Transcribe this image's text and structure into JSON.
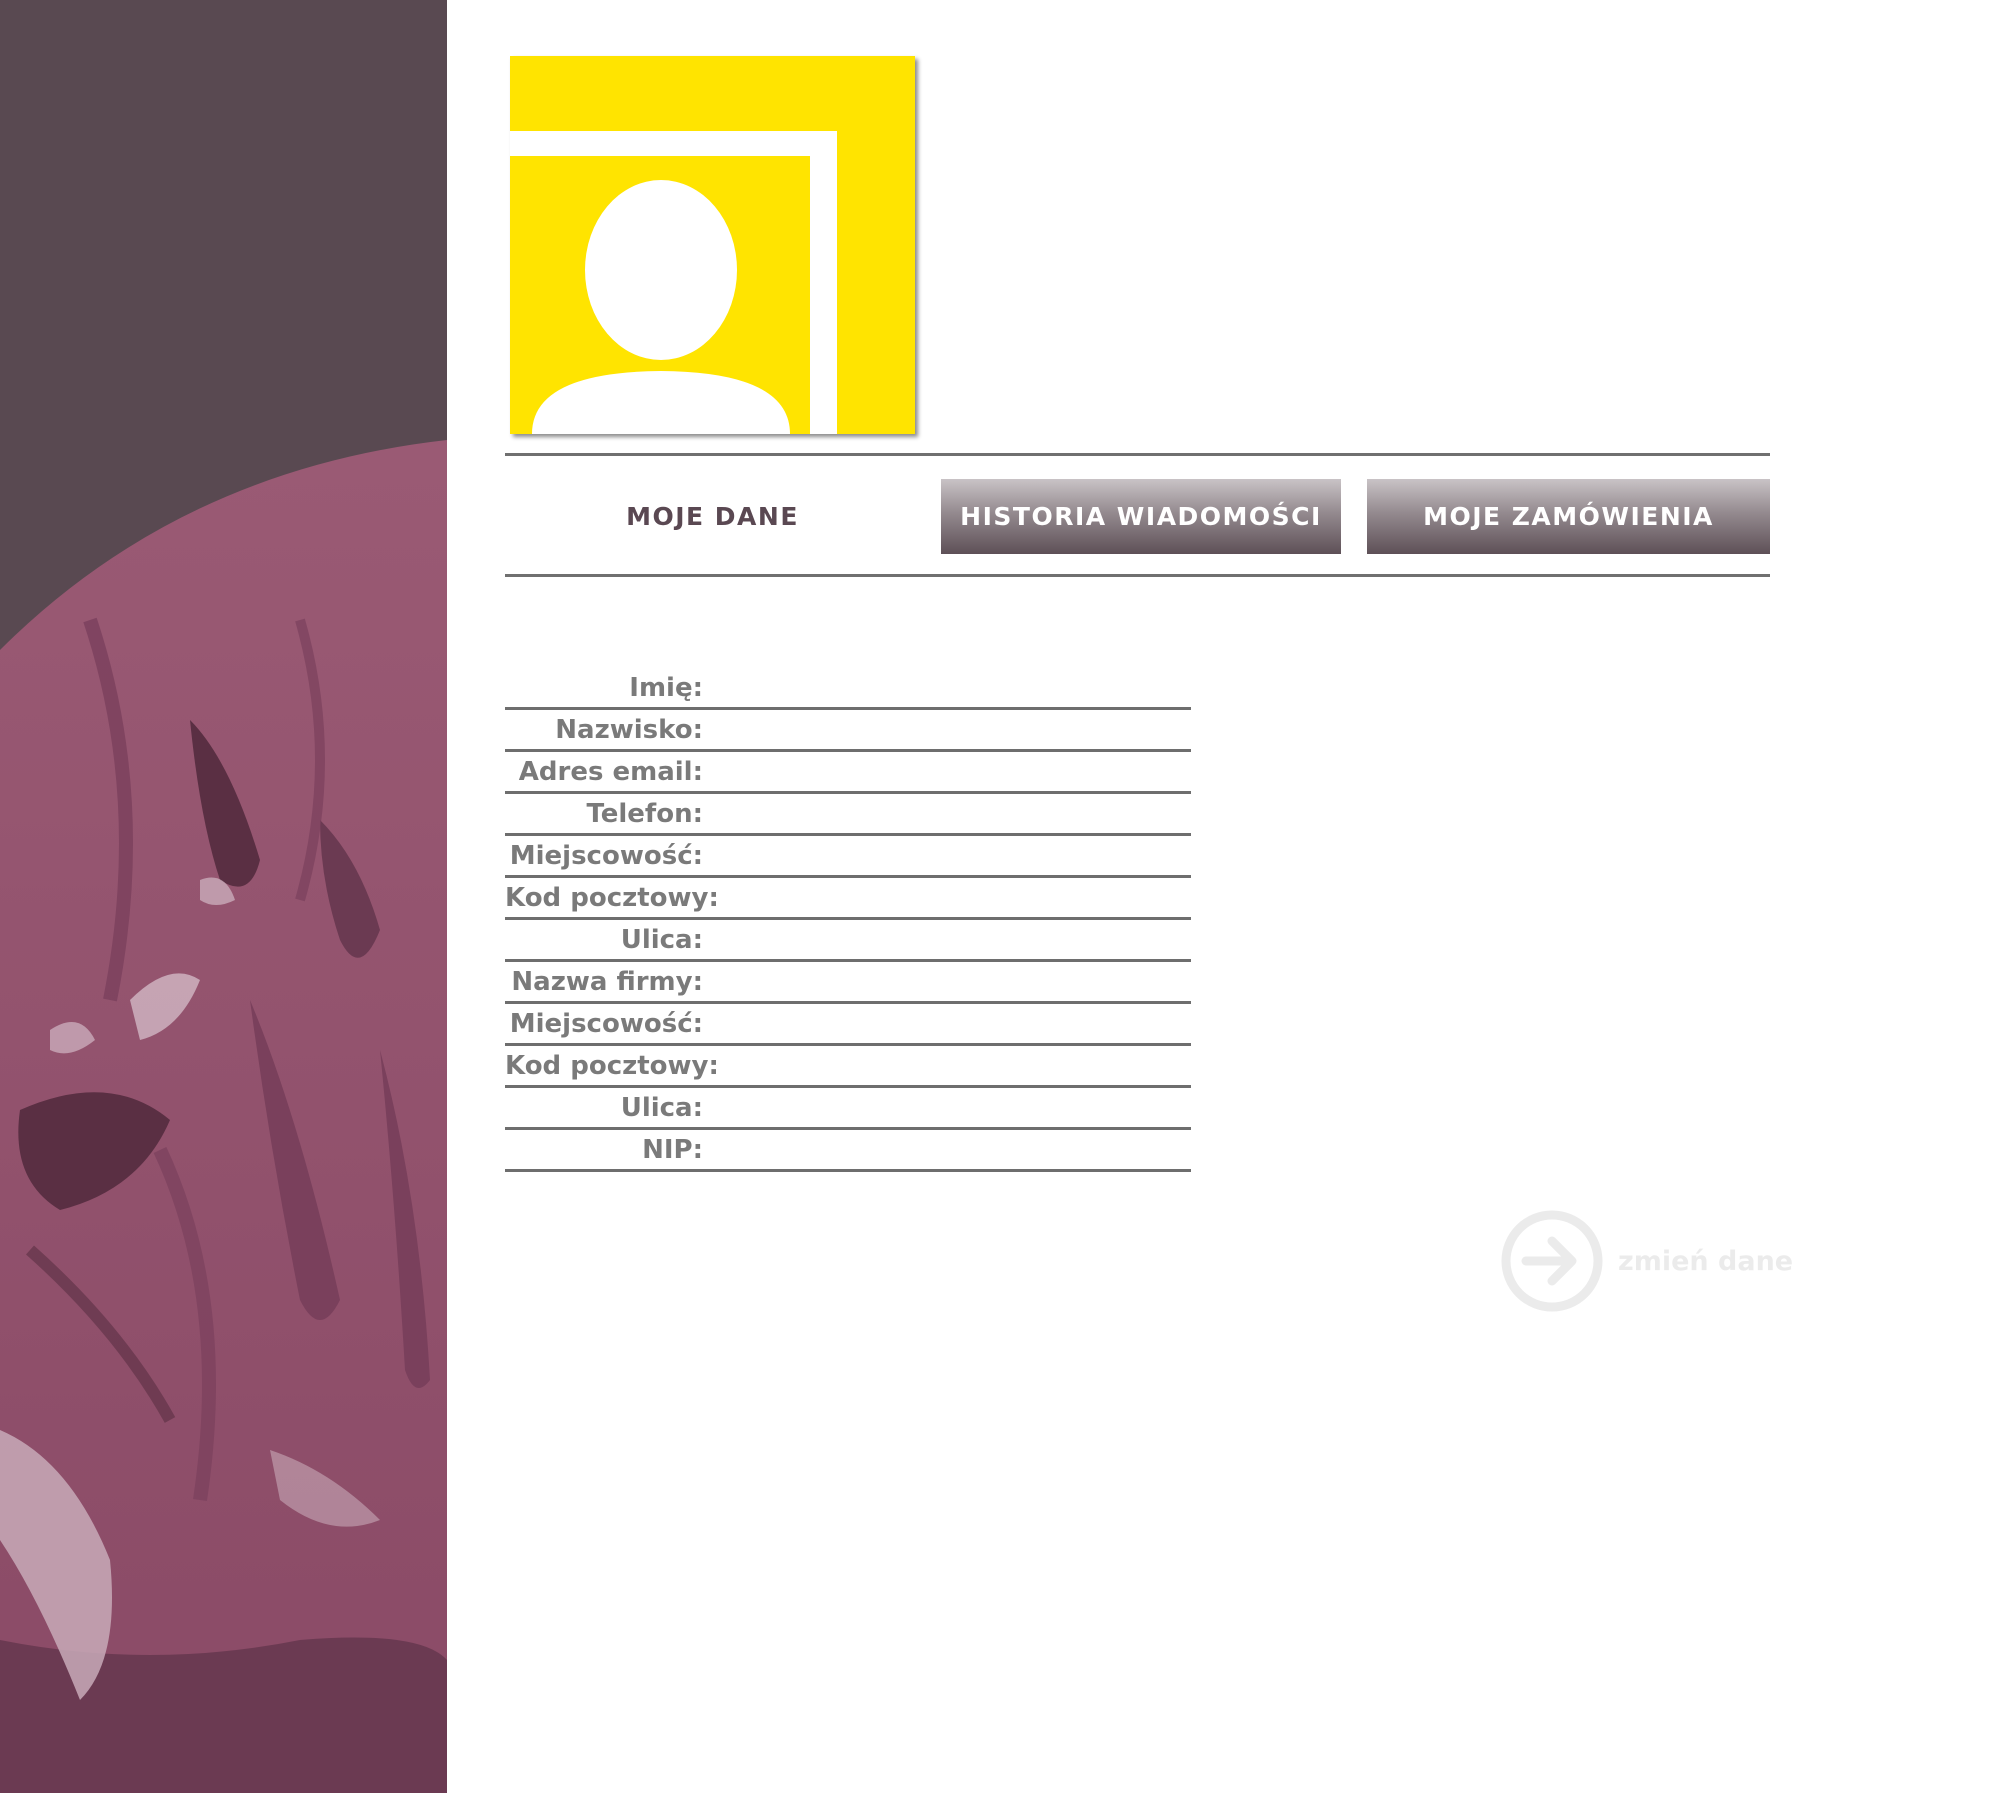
{
  "tabs": [
    {
      "label": "MOJE  DANE",
      "active": true
    },
    {
      "label": "HISTORIA  WIADOMOŚCI",
      "active": false
    },
    {
      "label": "MOJE  ZAMÓWIENIA",
      "active": false
    }
  ],
  "fields": [
    {
      "label": "Imię:",
      "value": ""
    },
    {
      "label": "Nazwisko:",
      "value": ""
    },
    {
      "label": "Adres email:",
      "value": ""
    },
    {
      "label": "Telefon:",
      "value": ""
    },
    {
      "label": "Miejscowość:",
      "value": ""
    },
    {
      "label": "Kod pocztowy:",
      "value": ""
    },
    {
      "label": "Ulica:",
      "value": ""
    },
    {
      "label": "Nazwa firmy:",
      "value": ""
    },
    {
      "label": "Miejscowość:",
      "value": ""
    },
    {
      "label": "Kod pocztowy:",
      "value": ""
    },
    {
      "label": "Ulica:",
      "value": ""
    },
    {
      "label": "NIP:",
      "value": ""
    }
  ],
  "change_link": {
    "label": "zmień dane",
    "icon": "arrow-right-circle-icon"
  },
  "avatar": {
    "icon": "user-silhouette-icon"
  },
  "colors": {
    "panel_dark": "#594951",
    "panel_magenta": "#965670",
    "avatar_yellow": "#ffe400",
    "tab_text_active": "#5a4852",
    "divider": "#707070",
    "label_text": "#7a7a7a",
    "link_light": "#ebebeb"
  }
}
